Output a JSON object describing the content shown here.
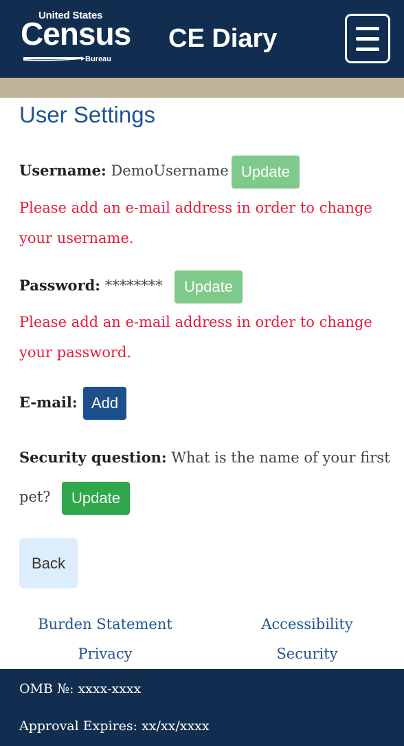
{
  "header": {
    "logo": {
      "united_states": "United States",
      "census": "Census",
      "bureau": "Bureau"
    },
    "app_title": "CE Diary",
    "menu_icon": "hamburger-menu-icon"
  },
  "page": {
    "title": "User Settings"
  },
  "username": {
    "label": "Username:",
    "value": "DemoUsername",
    "button": "Update",
    "error": "Please add an e-mail address in order to change your username."
  },
  "password": {
    "label": "Password:",
    "value": "********",
    "button": "Update",
    "error": "Please add an e-mail address in order to change your password."
  },
  "email": {
    "label": "E-mail:",
    "button": "Add"
  },
  "security": {
    "label": "Security question:",
    "value_line1": "What is the name of your first",
    "value_line2": "pet?",
    "button": "Update"
  },
  "back_button": "Back",
  "links": {
    "burden": "Burden Statement",
    "accessibility": "Accessibility",
    "privacy": "Privacy",
    "security": "Security"
  },
  "footer": {
    "omb": "OMB №: xxxx-xxxx",
    "approval": "Approval Expires: xx/xx/xxxx"
  },
  "colors": {
    "header_bg": "#112e51",
    "tan_bar": "#bfb39a",
    "title_blue": "#205493",
    "error_red": "#e31c3d",
    "update_green": "#2ea84a",
    "update_disabled": "#7fca8a",
    "add_blue": "#1d4f8c",
    "back_bg": "#dceefe"
  }
}
